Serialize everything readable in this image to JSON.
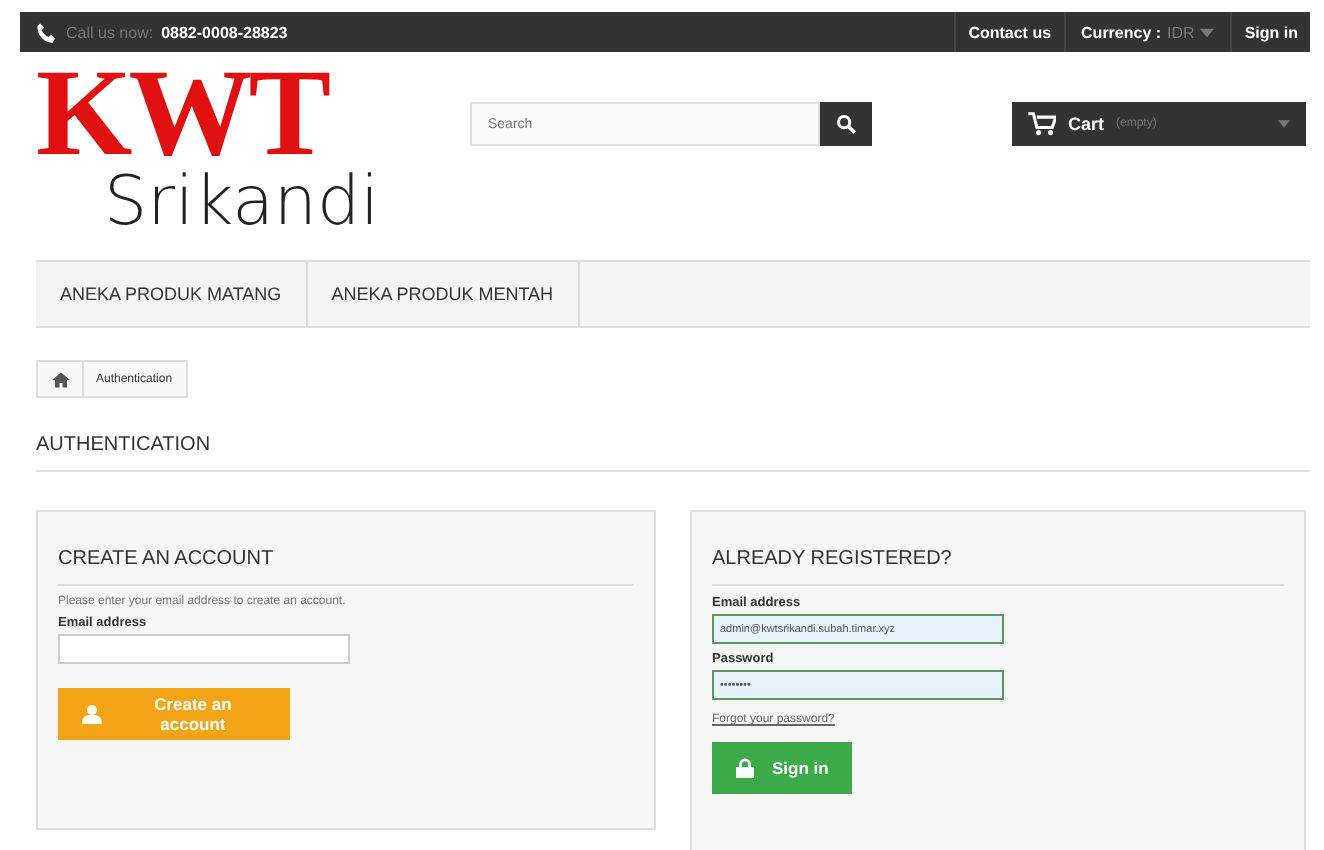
{
  "top_bar": {
    "call_label": "Call us now:",
    "phone": "0882-0008-28823",
    "contact": "Contact us",
    "currency_label": "Currency :",
    "currency_value": "IDR",
    "sign_in": "Sign in"
  },
  "logo": {
    "main": "KWT",
    "sub": "Srikandi"
  },
  "search": {
    "placeholder": "Search"
  },
  "cart": {
    "label": "Cart",
    "status": "(empty)"
  },
  "nav": [
    {
      "label": "ANEKA PRODUK MATANG",
      "selected": false
    },
    {
      "label": "ANEKA PRODUK MENTAH",
      "selected": false
    }
  ],
  "breadcrumb": {
    "current": "Authentication"
  },
  "page_title": "AUTHENTICATION",
  "create_account": {
    "title": "CREATE AN ACCOUNT",
    "hint": "Please enter your email address to create an account.",
    "email_label": "Email address",
    "button": "Create an account"
  },
  "sign_in_box": {
    "title": "ALREADY REGISTERED?",
    "email_label": "Email address",
    "email_value": "admin@kwtsrikandi.subah.timar.xyz",
    "password_label": "Password",
    "password_value": "••••••••",
    "forgot": "Forgot your password?",
    "button": "Sign in"
  }
}
